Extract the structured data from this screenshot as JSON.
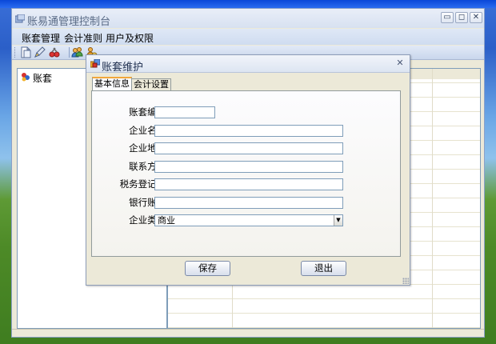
{
  "main_window": {
    "title": "账易通管理控制台",
    "desktop_partial_title": "账易通管理控制台",
    "controls": {
      "minimize": "▭",
      "maximize": "◻",
      "close": "✕"
    }
  },
  "menubar": {
    "items": [
      "账套管理",
      "会计准则",
      "用户及权限"
    ]
  },
  "toolbar": {
    "icons": [
      "new-document-icon",
      "edit-icon",
      "delete-icon",
      "users-icon",
      "users-settings-icon"
    ]
  },
  "tree": {
    "root_label": "账套"
  },
  "dialog": {
    "title": "账套维护",
    "close_glyph": "✕",
    "tabs": [
      {
        "label": "基本信息",
        "active": true
      },
      {
        "label": "会计设置",
        "active": false
      }
    ],
    "fields": [
      {
        "label": "账套编码:",
        "value": "",
        "placeholder": ""
      },
      {
        "label": "企业名称:",
        "value": "",
        "placeholder": ""
      },
      {
        "label": "企业地址:",
        "value": "",
        "placeholder": ""
      },
      {
        "label": "联系方式:",
        "value": "",
        "placeholder": ""
      },
      {
        "label": "税务登记号:",
        "value": "",
        "placeholder": ""
      },
      {
        "label": "银行账号:",
        "value": "",
        "placeholder": ""
      }
    ],
    "type_field": {
      "label": "企业类型:",
      "selected": "商业"
    },
    "buttons": {
      "save": "保存",
      "exit": "退出"
    }
  },
  "colors": {
    "window_face": "#ece9d8",
    "titlebar_light": "#e9eef8",
    "input_border": "#7f9db9",
    "active_tab_accent": "#f2a73b"
  }
}
